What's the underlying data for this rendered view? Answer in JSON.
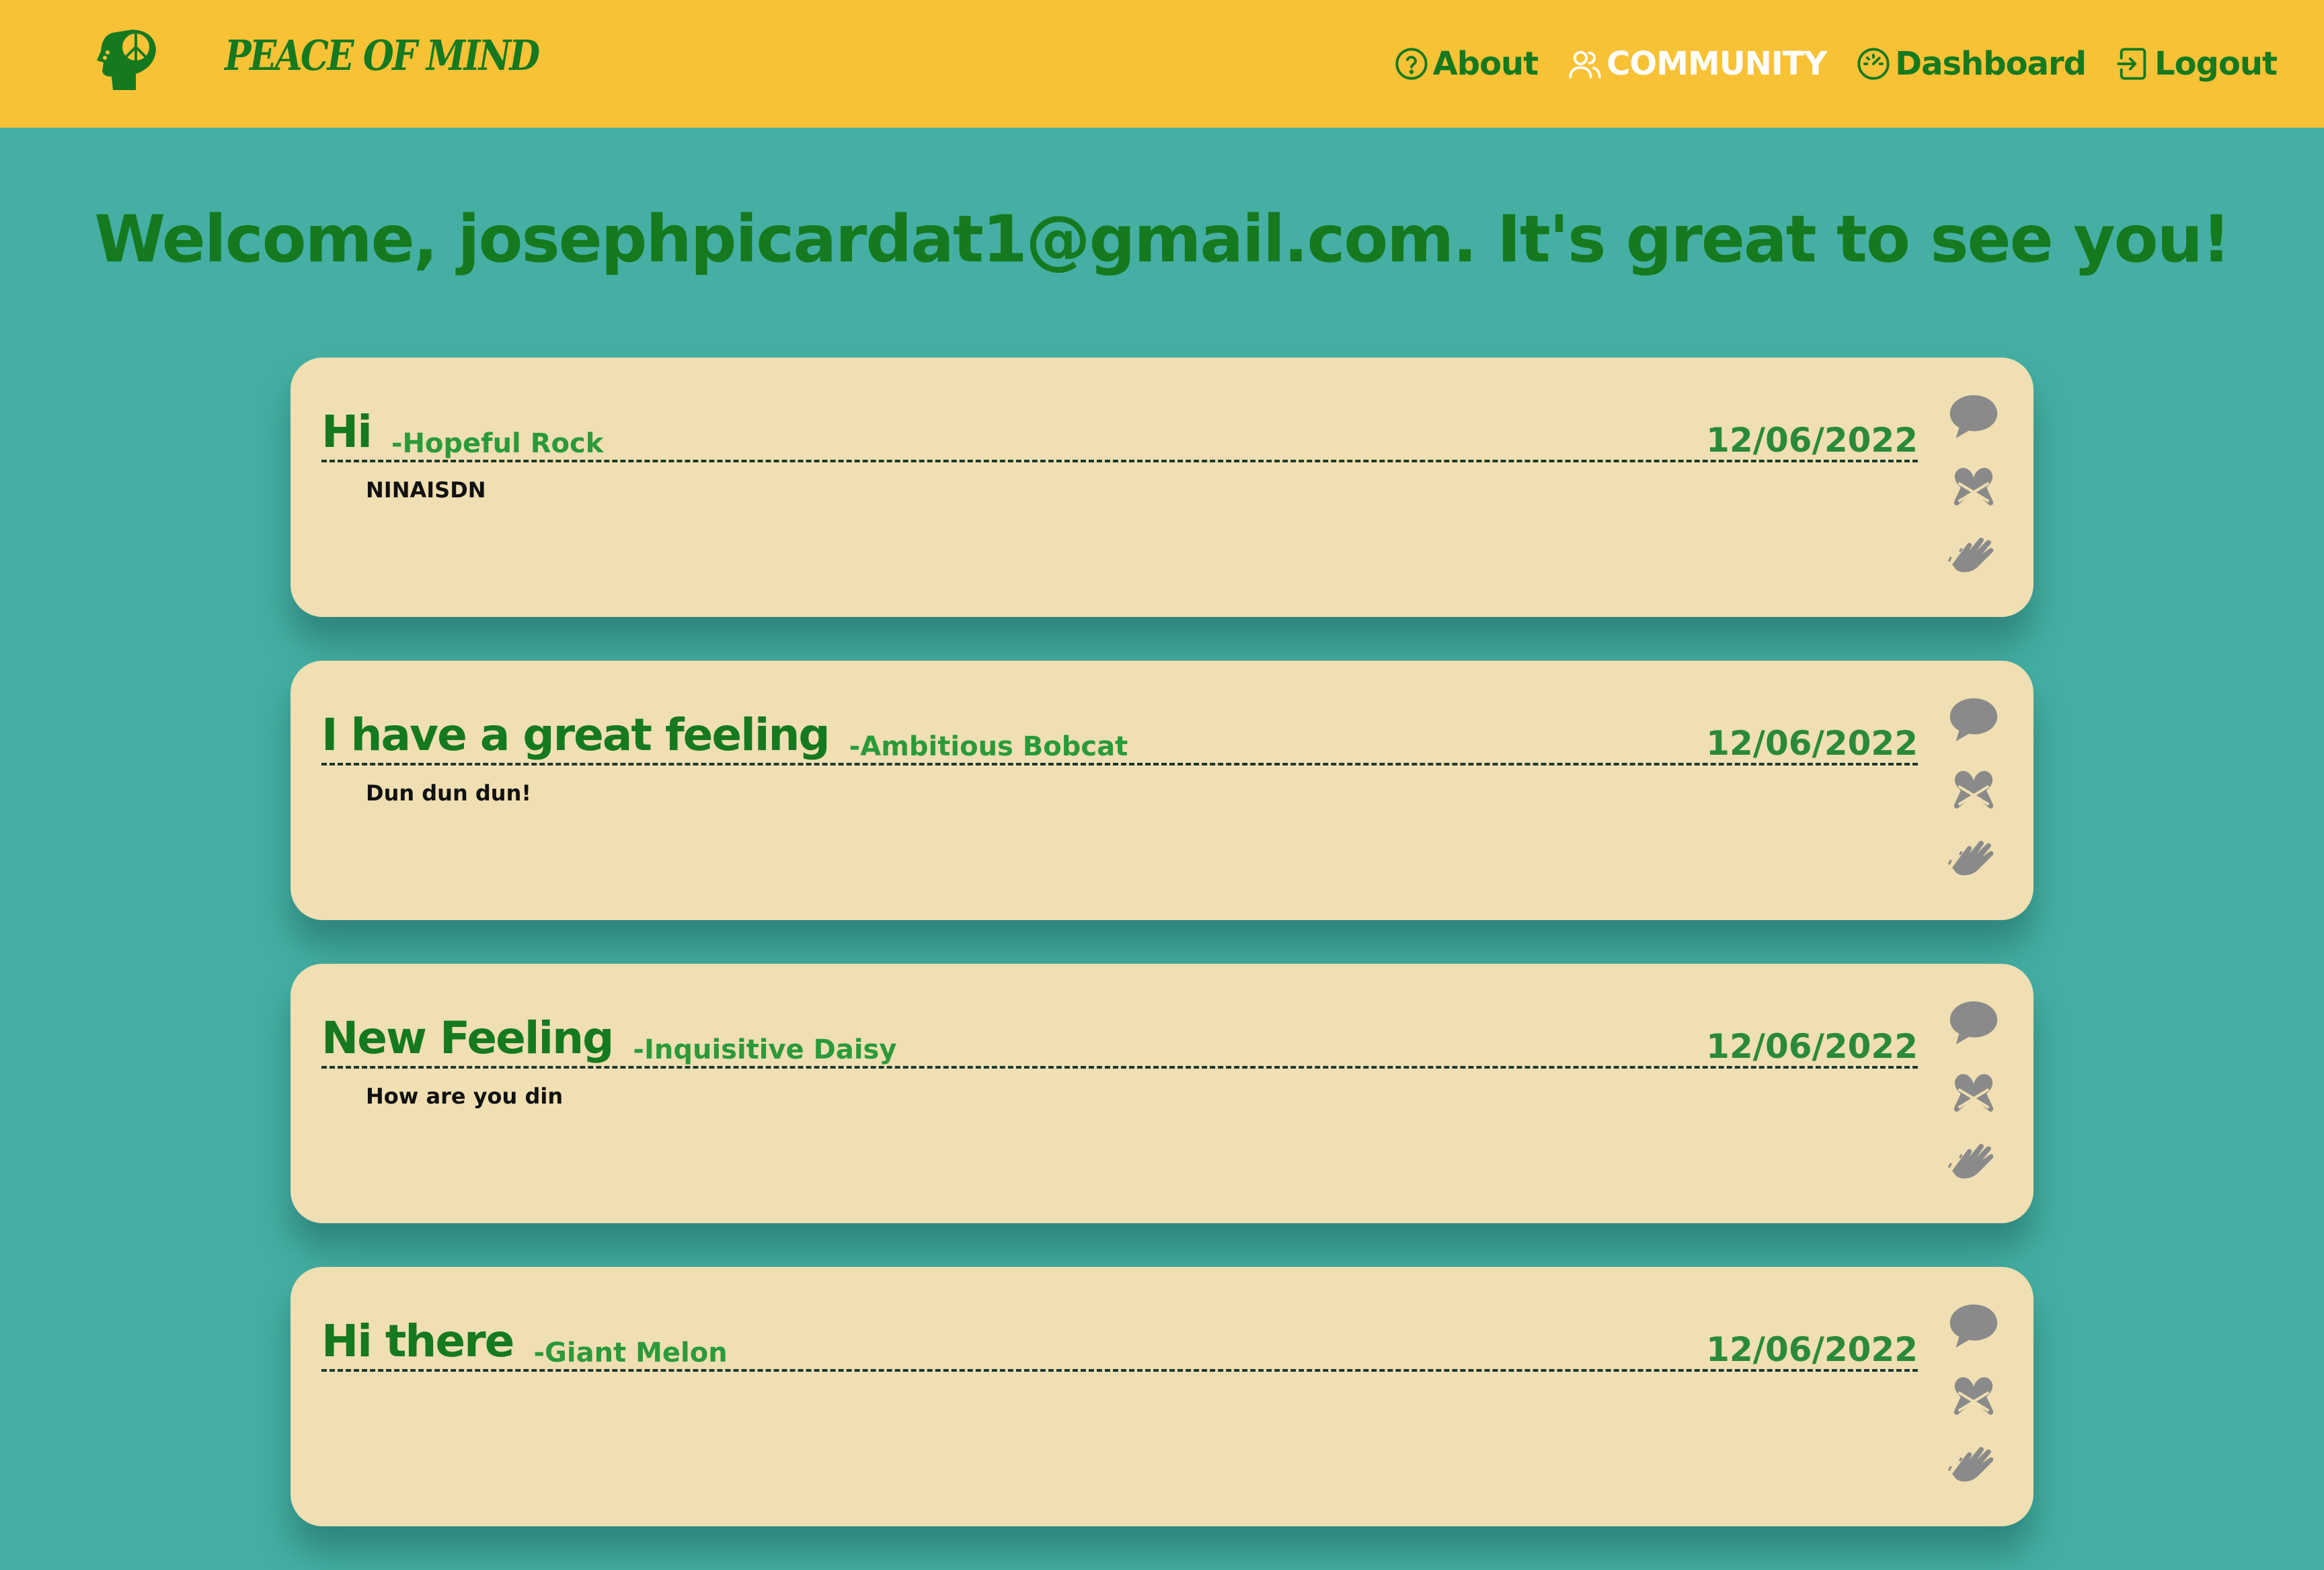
{
  "app": {
    "name": "PEACE OF MIND"
  },
  "nav": {
    "about": "About",
    "community": "COMMUNITY",
    "dashboard": "Dashboard",
    "logout": "Logout"
  },
  "welcome": "Welcome, josephpicardat1@gmail.com. It's great to see you!",
  "posts": [
    {
      "title": "Hi",
      "author": "-Hopeful Rock",
      "date": "12/06/2022",
      "body": "NINAISDN"
    },
    {
      "title": "I have a great feeling",
      "author": "-Ambitious Bobcat",
      "date": "12/06/2022",
      "body": "Dun dun dun!"
    },
    {
      "title": "New Feeling",
      "author": "-Inquisitive Daisy",
      "date": "12/06/2022",
      "body": "How are you din"
    },
    {
      "title": "Hi there",
      "author": "-Giant Melon",
      "date": "12/06/2022",
      "body": ""
    }
  ],
  "icons": {
    "comment": "comment-icon",
    "hug": "hug-icon",
    "clap": "clap-icon"
  },
  "colors": {
    "navbar": "#f8c236",
    "background": "#45afa3",
    "card": "#efdfb2",
    "brand_green": "#15791f",
    "icon_gray": "#8a8a8a"
  }
}
